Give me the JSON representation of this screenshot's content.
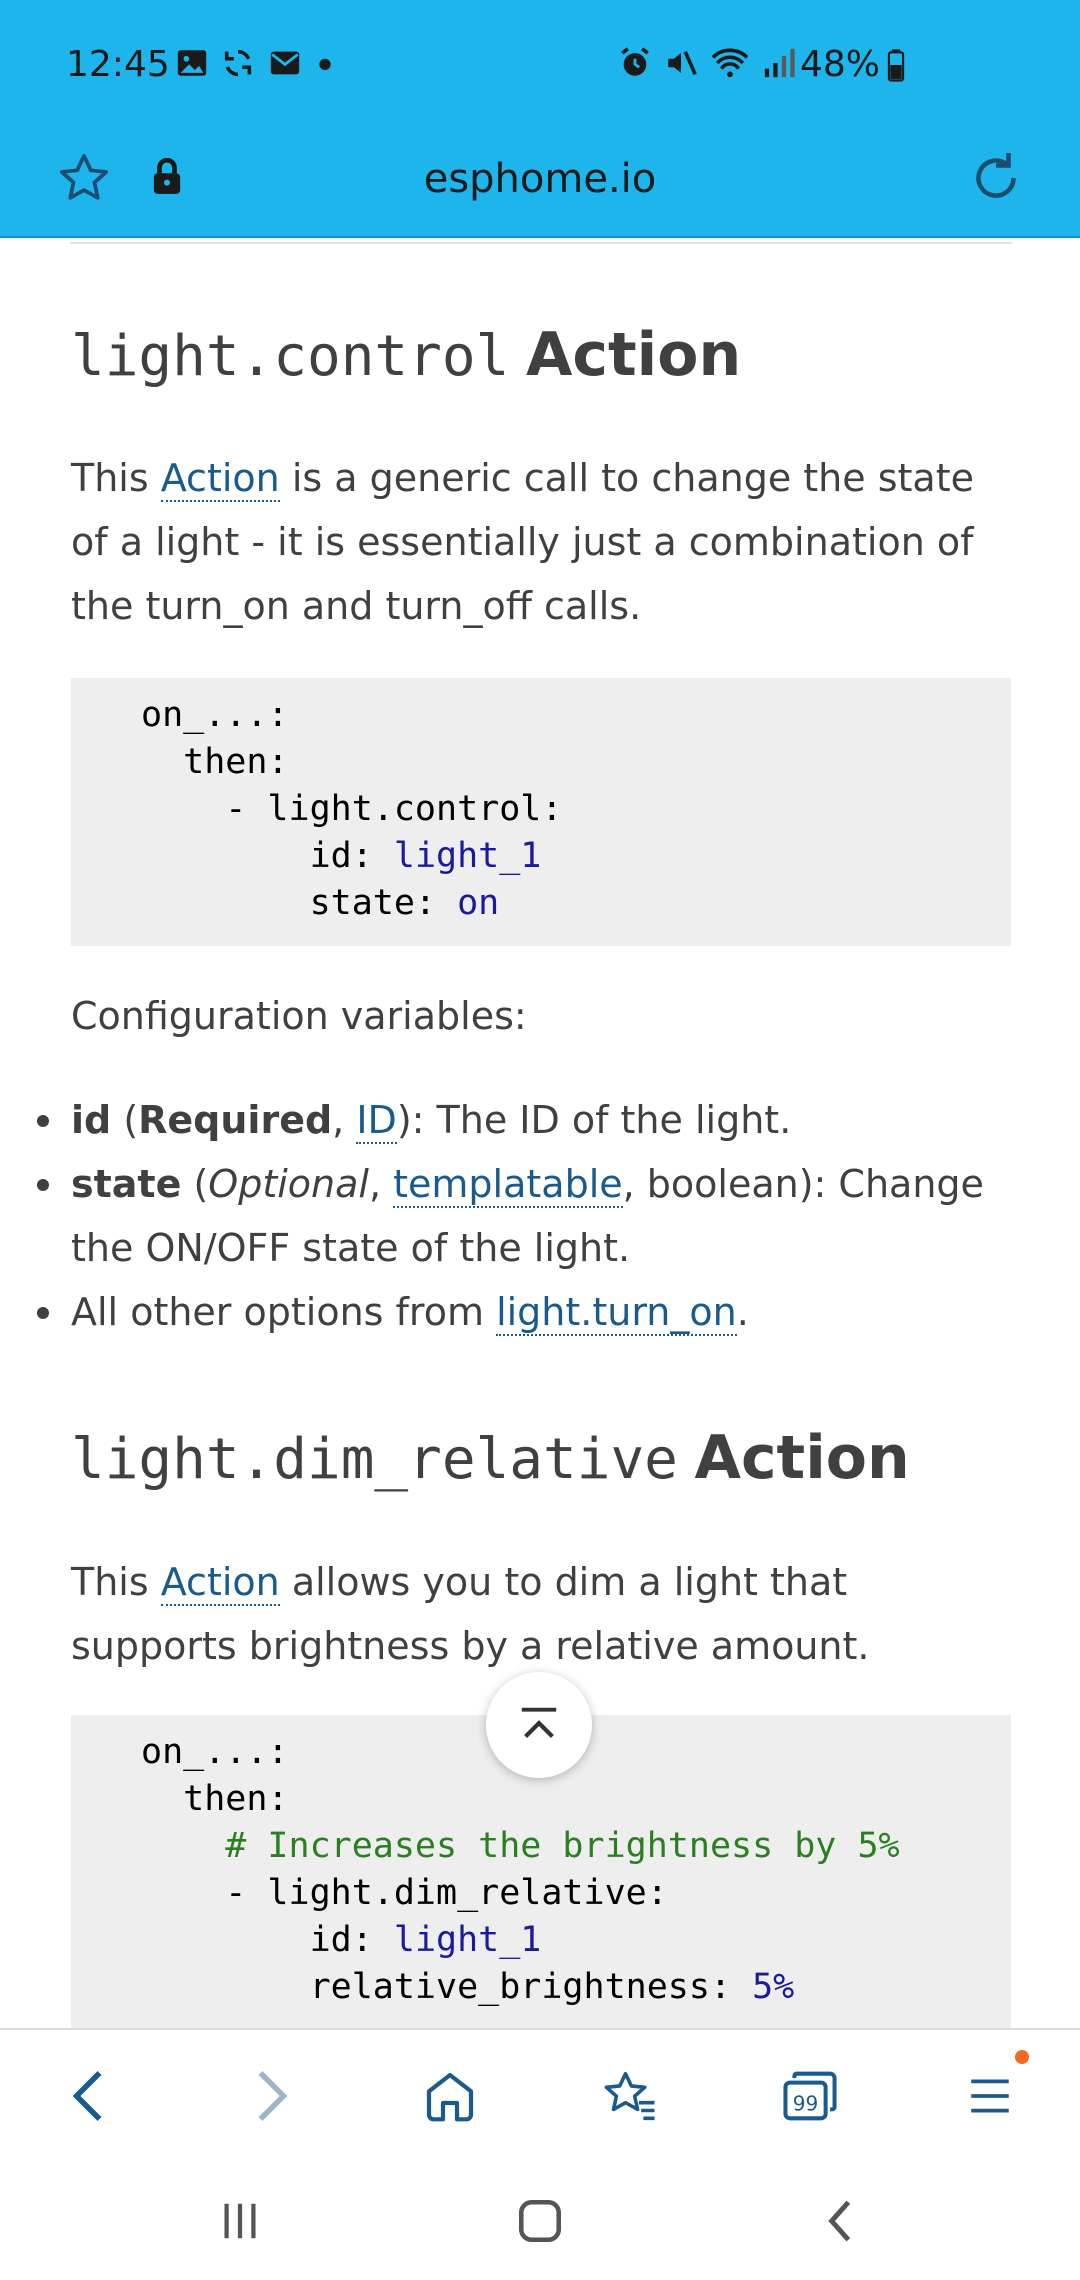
{
  "status_bar": {
    "time": "12:45",
    "battery": "48%",
    "left_icons": [
      "image-icon",
      "sync-icon",
      "mail-icon",
      "dot-icon"
    ],
    "right_icons": [
      "alarm-icon",
      "mute-icon",
      "wifi-icon",
      "signal-icon",
      "battery-icon"
    ]
  },
  "browser": {
    "url": "esphome.io"
  },
  "section1": {
    "heading_code": "light.control",
    "heading_word": "Action",
    "intro_pre": "This ",
    "intro_link": "Action",
    "intro_post": " is a generic call to change the state of a light - it is essentially just a combination of the turn_on and turn_off calls.",
    "code": {
      "l1": "on_...:",
      "l2": "  then:",
      "l3": "    - light.control:",
      "l4_key": "        id: ",
      "l4_val": "light_1",
      "l5_key": "        state: ",
      "l5_val": "on"
    },
    "config_label": "Configuration variables:",
    "options": [
      {
        "name": "id",
        "open": " (",
        "req": "Required",
        "sep": ", ",
        "link": "ID",
        "rest": "): The ID of the light."
      },
      {
        "name": "state",
        "open": " (",
        "opt": "Optional",
        "sep": ", ",
        "link": "templatable",
        "rest": ", boolean): Change the ON/OFF state of the light."
      },
      {
        "text": "All other options from ",
        "link": "light.turn_on",
        "end": "."
      }
    ]
  },
  "section2": {
    "heading_code": "light.dim_relative",
    "heading_word": "Action",
    "intro_pre": "This ",
    "intro_link": "Action",
    "intro_post": " allows you to dim a light that supports brightness by a relative amount.",
    "code": {
      "l1": "on_...:",
      "l2": "  then:",
      "l3_comment": "    # Increases the brightness by 5%",
      "l4": "    - light.dim_relative:",
      "l5_key": "        id: ",
      "l5_val": "light_1",
      "l6_key": "        relative_brightness: ",
      "l6_val": "5%"
    }
  },
  "bottom_bar": {
    "buttons": [
      "back-icon",
      "forward-icon",
      "home-icon",
      "bookmarks-icon",
      "tabs-icon",
      "menu-icon"
    ],
    "tabs_count": "99"
  },
  "system_nav": [
    "recents-icon",
    "home-nav-icon",
    "back-nav-icon"
  ]
}
